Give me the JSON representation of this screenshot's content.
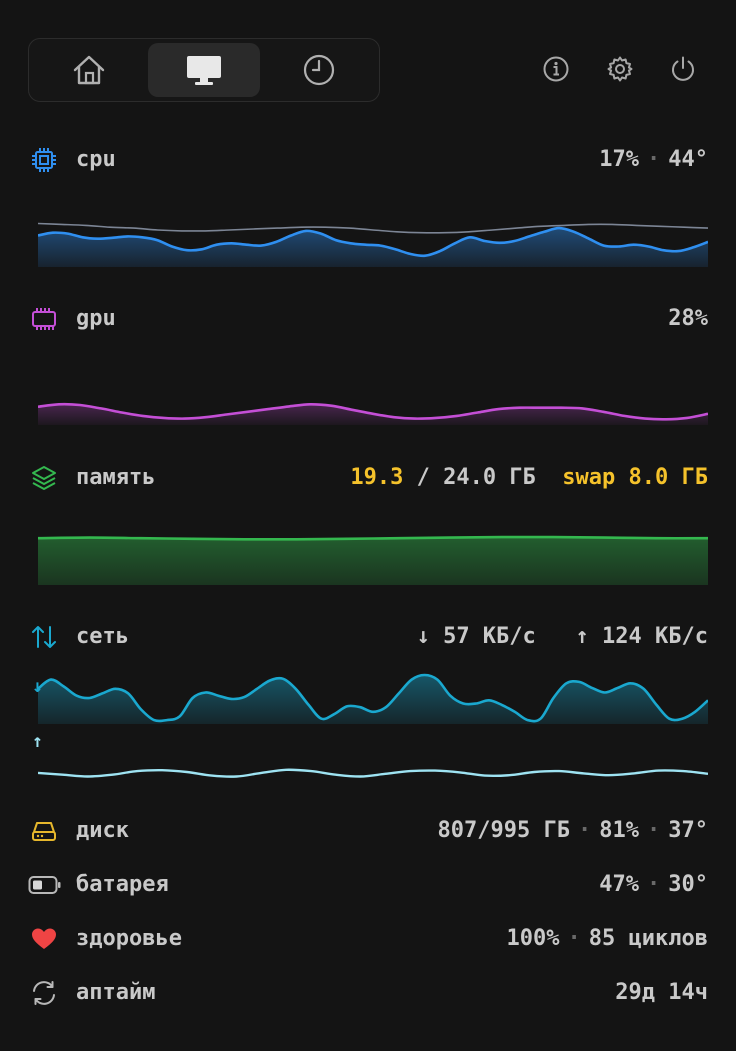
{
  "nav": {
    "tabs": [
      {
        "name": "home",
        "icon": "home-icon"
      },
      {
        "name": "monitor",
        "icon": "monitor-icon",
        "active": true
      },
      {
        "name": "history",
        "icon": "clock-icon"
      }
    ],
    "actions": [
      "info-icon",
      "gear-icon",
      "power-icon"
    ]
  },
  "cpu": {
    "label": "cpu",
    "usage": "17%",
    "temp": "44°",
    "color": "#2f8ff0",
    "series": [
      0.62,
      0.68,
      0.66,
      0.58,
      0.55,
      0.57,
      0.6,
      0.58,
      0.52,
      0.38,
      0.3,
      0.32,
      0.42,
      0.45,
      0.42,
      0.4,
      0.48,
      0.62,
      0.72,
      0.66,
      0.52,
      0.45,
      0.42,
      0.4,
      0.32,
      0.22,
      0.18,
      0.28,
      0.45,
      0.58,
      0.5,
      0.46,
      0.5,
      0.6,
      0.7,
      0.78,
      0.7,
      0.55,
      0.4,
      0.38,
      0.42,
      0.38,
      0.3,
      0.28,
      0.36,
      0.48
    ],
    "temp_series": [
      0.88,
      0.86,
      0.84,
      0.8,
      0.78,
      0.74,
      0.72,
      0.72,
      0.74,
      0.76,
      0.78,
      0.8,
      0.8,
      0.78,
      0.74,
      0.7,
      0.68,
      0.68,
      0.7,
      0.74,
      0.78,
      0.82,
      0.84,
      0.86,
      0.86,
      0.84,
      0.82,
      0.8,
      0.78
    ]
  },
  "gpu": {
    "label": "gpu",
    "usage": "28%",
    "color": "#c44fd6",
    "series": [
      0.45,
      0.52,
      0.5,
      0.4,
      0.28,
      0.18,
      0.12,
      0.1,
      0.14,
      0.22,
      0.3,
      0.38,
      0.46,
      0.52,
      0.48,
      0.36,
      0.24,
      0.14,
      0.1,
      0.12,
      0.18,
      0.28,
      0.38,
      0.42,
      0.42,
      0.42,
      0.4,
      0.3,
      0.18,
      0.1,
      0.08,
      0.12,
      0.24
    ]
  },
  "memory": {
    "label": "память",
    "used": "19.3",
    "sep": " / ",
    "total": "24.0 ГБ",
    "swap": "swap 8.0 ГБ",
    "color": "#34b84f",
    "series": [
      0.8,
      0.81,
      0.8,
      0.79,
      0.78,
      0.78,
      0.79,
      0.8,
      0.81,
      0.82,
      0.82,
      0.81,
      0.8,
      0.8
    ]
  },
  "network": {
    "label": "сеть",
    "down": "↓ 57 КБ/с",
    "up": "↑ 124 КБ/с",
    "down_arrow": "↓",
    "up_arrow": "↑",
    "color_down": "#1aa8cf",
    "color_up": "#9ee3f2",
    "down_series": [
      0.7,
      0.9,
      0.75,
      0.55,
      0.5,
      0.6,
      0.7,
      0.6,
      0.25,
      0.02,
      0.02,
      0.1,
      0.5,
      0.62,
      0.55,
      0.48,
      0.52,
      0.7,
      0.88,
      0.92,
      0.7,
      0.35,
      0.05,
      0.15,
      0.32,
      0.3,
      0.2,
      0.3,
      0.6,
      0.9,
      1.0,
      0.9,
      0.55,
      0.38,
      0.38,
      0.45,
      0.35,
      0.2,
      0.02,
      0.05,
      0.5,
      0.82,
      0.85,
      0.72,
      0.62,
      0.72,
      0.82,
      0.7,
      0.35,
      0.05,
      0.05,
      0.2,
      0.45
    ],
    "up_series": [
      0.45,
      0.35,
      0.25,
      0.35,
      0.55,
      0.6,
      0.5,
      0.3,
      0.25,
      0.45,
      0.62,
      0.55,
      0.35,
      0.25,
      0.4,
      0.55,
      0.58,
      0.48,
      0.3,
      0.32,
      0.5,
      0.55,
      0.42,
      0.32,
      0.42,
      0.58,
      0.55,
      0.4
    ]
  },
  "disk": {
    "label": "диск",
    "used": "807/995 ГБ",
    "pct": "81%",
    "temp": "37°",
    "color": "#e6b72c"
  },
  "battery": {
    "label": "батарея",
    "pct": "47%",
    "temp": "30°"
  },
  "health": {
    "label": "здоровье",
    "pct": "100%",
    "cycles": "85 циклов",
    "color": "#ef4444"
  },
  "uptime": {
    "label": "аптайм",
    "value": "29д 14ч"
  }
}
